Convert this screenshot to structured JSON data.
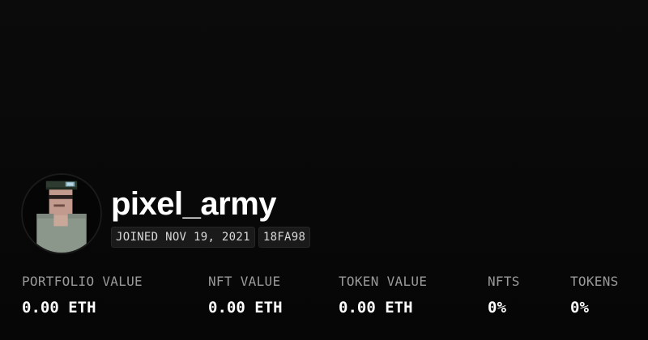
{
  "profile": {
    "username": "pixel_army",
    "joined": "JOINED NOV 19, 2021",
    "address_tag": "18FA98",
    "avatar_icon": "pixel-soldier-avatar"
  },
  "stats": [
    {
      "label": "PORTFOLIO VALUE",
      "value": "0.00 ETH"
    },
    {
      "label": "NFT VALUE",
      "value": "0.00 ETH"
    },
    {
      "label": "TOKEN VALUE",
      "value": "0.00 ETH"
    },
    {
      "label": "NFTS",
      "value": "0%"
    },
    {
      "label": "TOKENS",
      "value": "0%"
    }
  ],
  "colors": {
    "background": "#0a0a0a",
    "text_primary": "#ffffff",
    "text_muted": "#9a9a9a",
    "tag_background": "#1a1a1a"
  }
}
